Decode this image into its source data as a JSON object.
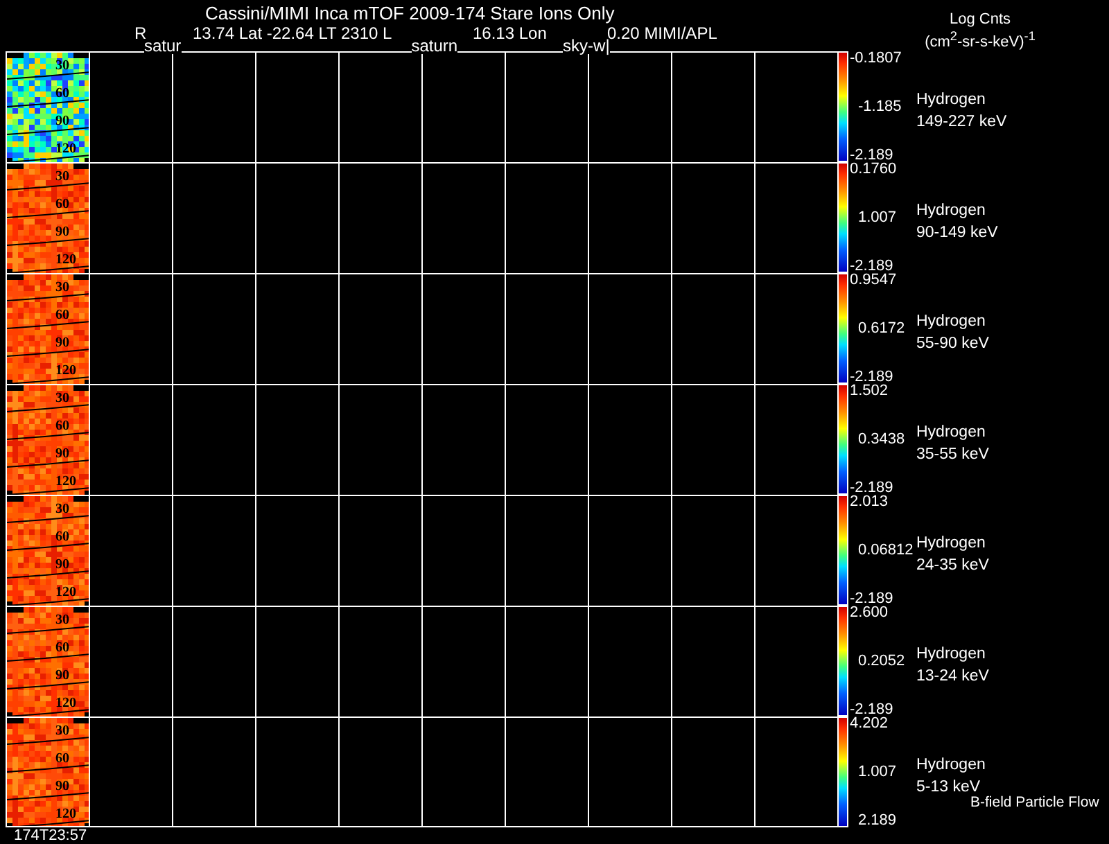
{
  "title": "Cassini/MIMI Inca mTOF  2009-174   Stare   Ions Only",
  "info_line": [
    "R",
    "13.74 Lat -22.64 LT 2310 L",
    "16.13 Lon",
    "0.20  MIMI/APL"
  ],
  "overlay_labels": [
    "satur",
    "saturn",
    "sky-w|"
  ],
  "units": {
    "label": "Log Cnts",
    "unit": "(cm$^{2}$-sr-s-keV)$^{-1}$"
  },
  "panels": [
    {
      "kind": "cool",
      "contours": [
        "30",
        "60",
        "90",
        "120"
      ],
      "scale_max": "-0.1807",
      "scale_mid": "-1.185",
      "scale_min": "-2.189",
      "species": "Hydrogen",
      "energy": "149-227 keV"
    },
    {
      "kind": "hot",
      "contours": [
        "30",
        "60",
        "90",
        "120"
      ],
      "scale_max": "0.1760",
      "scale_mid": "1.007",
      "scale_min": "-2.189",
      "species": "Hydrogen",
      "energy": "90-149 keV"
    },
    {
      "kind": "hot",
      "contours": [
        "30",
        "60",
        "90",
        "120"
      ],
      "scale_max": "0.9547",
      "scale_mid": "0.6172",
      "scale_min": "-2.189",
      "species": "Hydrogen",
      "energy": "55-90 keV"
    },
    {
      "kind": "hot",
      "contours": [
        "30",
        "60",
        "90",
        "120"
      ],
      "scale_max": "1.502",
      "scale_mid": "0.3438",
      "scale_min": "-2.189",
      "species": "Hydrogen",
      "energy": "35-55 keV"
    },
    {
      "kind": "hot",
      "contours": [
        "30",
        "60",
        "90",
        "120"
      ],
      "scale_max": "2.013",
      "scale_mid": "0.06812",
      "scale_min": "-2.189",
      "species": "Hydrogen",
      "energy": "24-35 keV"
    },
    {
      "kind": "hot",
      "contours": [
        "30",
        "60",
        "90",
        "120"
      ],
      "scale_max": "2.600",
      "scale_mid": "0.2052",
      "scale_min": "-2.189",
      "species": "Hydrogen",
      "energy": "13-24 keV"
    },
    {
      "kind": "hot",
      "contours": [
        "30",
        "60",
        "90",
        "120"
      ],
      "scale_max": "4.202",
      "scale_mid": "1.007",
      "scale_min": "2.189",
      "species": "Hydrogen",
      "energy": "5-13 keV",
      "note": "B-field Particle Flow"
    }
  ],
  "time_label": "174T23:57"
}
